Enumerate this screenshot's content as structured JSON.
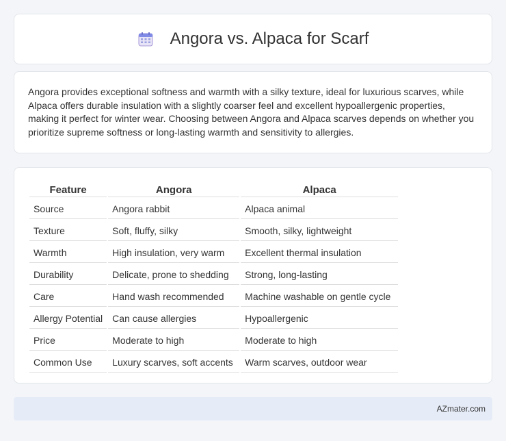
{
  "header": {
    "title": "Angora vs. Alpaca for Scarf",
    "icon": "calendar-icon"
  },
  "summary": {
    "text": "Angora provides exceptional softness and warmth with a silky texture, ideal for luxurious scarves, while Alpaca offers durable insulation with a slightly coarser feel and excellent hypoallergenic properties, making it perfect for winter wear. Choosing between Angora and Alpaca scarves depends on whether you prioritize supreme softness or long-lasting warmth and sensitivity to allergies."
  },
  "table": {
    "headers": [
      "Feature",
      "Angora",
      "Alpaca"
    ],
    "rows": [
      [
        "Source",
        "Angora rabbit",
        "Alpaca animal"
      ],
      [
        "Texture",
        "Soft, fluffy, silky",
        "Smooth, silky, lightweight"
      ],
      [
        "Warmth",
        "High insulation, very warm",
        "Excellent thermal insulation"
      ],
      [
        "Durability",
        "Delicate, prone to shedding",
        "Strong, long-lasting"
      ],
      [
        "Care",
        "Hand wash recommended",
        "Machine washable on gentle cycle"
      ],
      [
        "Allergy Potential",
        "Can cause allergies",
        "Hypoallergenic"
      ],
      [
        "Price",
        "Moderate to high",
        "Moderate to high"
      ],
      [
        "Common Use",
        "Luxury scarves, soft accents",
        "Warm scarves, outdoor wear"
      ]
    ]
  },
  "footer": {
    "brand": "AZmater.com"
  }
}
